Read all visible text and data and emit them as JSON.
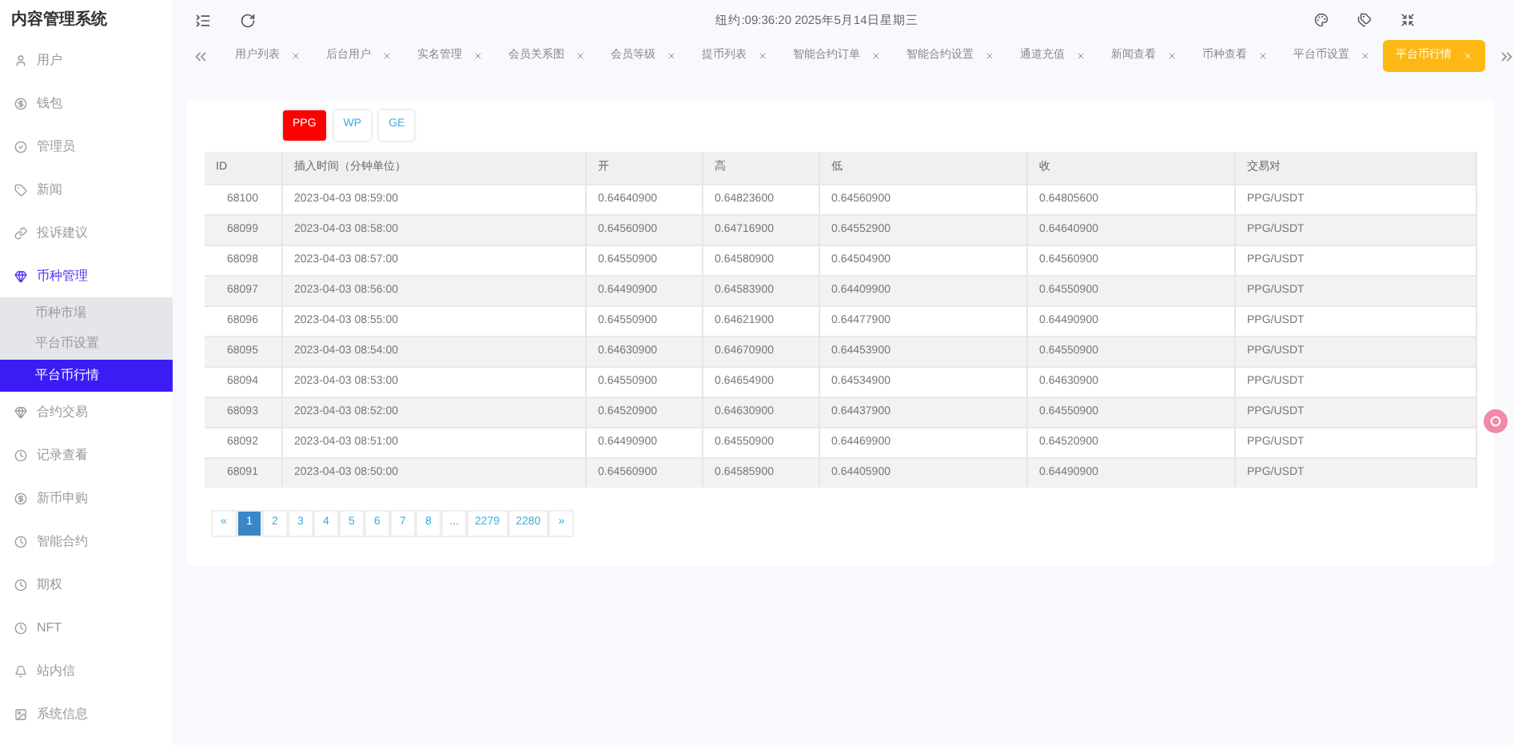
{
  "app_title": "内容管理系统",
  "sidebar": {
    "items": [
      {
        "label": "用户",
        "expanded": false
      },
      {
        "label": "钱包",
        "expanded": false
      },
      {
        "label": "管理员",
        "expanded": false
      },
      {
        "label": "新闻",
        "expanded": false
      },
      {
        "label": "投诉建议",
        "expanded": false
      },
      {
        "label": "币种管理",
        "expanded": true,
        "children": [
          {
            "label": "币种市場",
            "selected": false
          },
          {
            "label": "平台币设置",
            "selected": false
          },
          {
            "label": "平台币行情",
            "selected": true
          }
        ]
      },
      {
        "label": "合约交易",
        "expanded": false
      },
      {
        "label": "记录查看",
        "expanded": false
      },
      {
        "label": "新币申购",
        "expanded": false
      },
      {
        "label": "智能合约",
        "expanded": false
      },
      {
        "label": "期权",
        "expanded": false
      },
      {
        "label": "NFT",
        "expanded": false
      },
      {
        "label": "站内信",
        "expanded": false
      },
      {
        "label": "系统信息",
        "expanded": false
      }
    ]
  },
  "header": {
    "clock": "纽约:09:36:20 2025年5月14日星期三"
  },
  "tabs": [
    {
      "label": "用户列表",
      "selected": false
    },
    {
      "label": "后台用户",
      "selected": false
    },
    {
      "label": "实名管理",
      "selected": false
    },
    {
      "label": "会员关系图",
      "selected": false
    },
    {
      "label": "会员等级",
      "selected": false
    },
    {
      "label": "提币列表",
      "selected": false
    },
    {
      "label": "智能合约订单",
      "selected": false
    },
    {
      "label": "智能合约设置",
      "selected": false
    },
    {
      "label": "通道充值",
      "selected": false
    },
    {
      "label": "新闻查看",
      "selected": false
    },
    {
      "label": "币种查看",
      "selected": false
    },
    {
      "label": "平台币设置",
      "selected": false
    },
    {
      "label": "平台币行情",
      "selected": true
    }
  ],
  "coin_buttons": [
    {
      "label": "PPG",
      "selected": true
    },
    {
      "label": "WP",
      "selected": false
    },
    {
      "label": "GE",
      "selected": false
    }
  ],
  "table": {
    "columns": [
      "ID",
      "插入时间（分钟单位）",
      "开",
      "高",
      "低",
      "收",
      "交易对"
    ],
    "rows": [
      [
        "68100",
        "2023-04-03 08:59:00",
        "0.64640900",
        "0.64823600",
        "0.64560900",
        "0.64805600",
        "PPG/USDT"
      ],
      [
        "68099",
        "2023-04-03 08:58:00",
        "0.64560900",
        "0.64716900",
        "0.64552900",
        "0.64640900",
        "PPG/USDT"
      ],
      [
        "68098",
        "2023-04-03 08:57:00",
        "0.64550900",
        "0.64580900",
        "0.64504900",
        "0.64560900",
        "PPG/USDT"
      ],
      [
        "68097",
        "2023-04-03 08:56:00",
        "0.64490900",
        "0.64583900",
        "0.64409900",
        "0.64550900",
        "PPG/USDT"
      ],
      [
        "68096",
        "2023-04-03 08:55:00",
        "0.64550900",
        "0.64621900",
        "0.64477900",
        "0.64490900",
        "PPG/USDT"
      ],
      [
        "68095",
        "2023-04-03 08:54:00",
        "0.64630900",
        "0.64670900",
        "0.64453900",
        "0.64550900",
        "PPG/USDT"
      ],
      [
        "68094",
        "2023-04-03 08:53:00",
        "0.64550900",
        "0.64654900",
        "0.64534900",
        "0.64630900",
        "PPG/USDT"
      ],
      [
        "68093",
        "2023-04-03 08:52:00",
        "0.64520900",
        "0.64630900",
        "0.64437900",
        "0.64550900",
        "PPG/USDT"
      ],
      [
        "68092",
        "2023-04-03 08:51:00",
        "0.64490900",
        "0.64550900",
        "0.64469900",
        "0.64520900",
        "PPG/USDT"
      ],
      [
        "68091",
        "2023-04-03 08:50:00",
        "0.64560900",
        "0.64585900",
        "0.64405900",
        "0.64490900",
        "PPG/USDT"
      ]
    ]
  },
  "pagination": [
    {
      "label": "«",
      "selected": false
    },
    {
      "label": "1",
      "selected": true
    },
    {
      "label": "2",
      "selected": false
    },
    {
      "label": "3",
      "selected": false
    },
    {
      "label": "4",
      "selected": false
    },
    {
      "label": "5",
      "selected": false
    },
    {
      "label": "6",
      "selected": false
    },
    {
      "label": "7",
      "selected": false
    },
    {
      "label": "8",
      "selected": false
    },
    {
      "label": "...",
      "selected": false
    },
    {
      "label": "2279",
      "selected": false
    },
    {
      "label": "2280",
      "selected": false
    },
    {
      "label": "»",
      "selected": false
    }
  ]
}
